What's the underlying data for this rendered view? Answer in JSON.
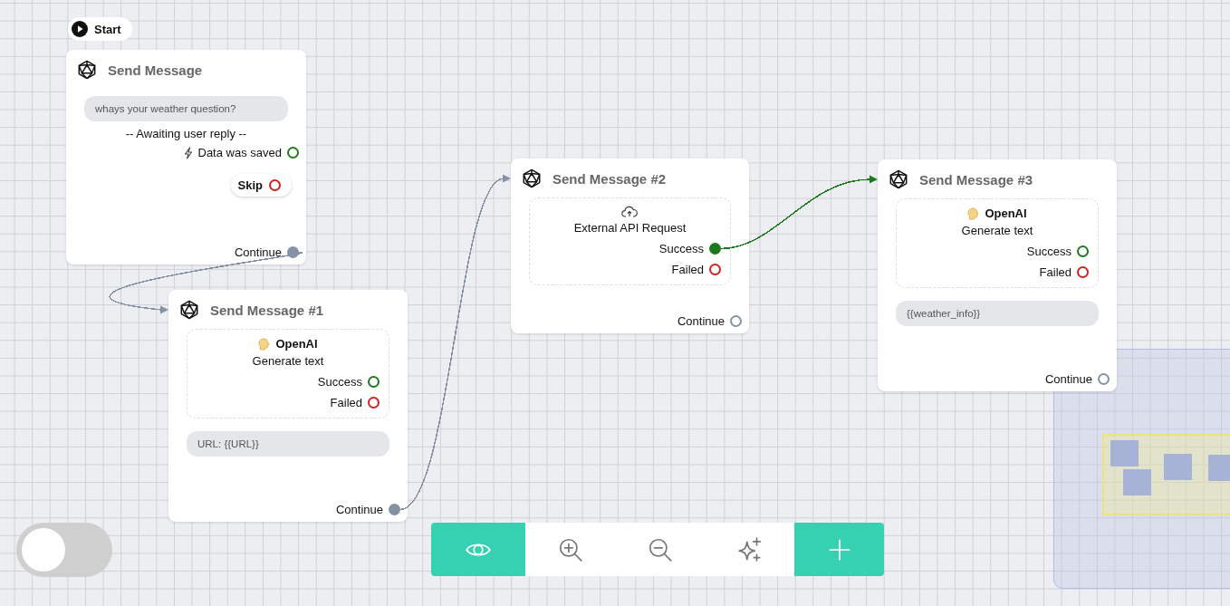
{
  "start": {
    "label": "Start"
  },
  "nodes": [
    {
      "title": "Send Message",
      "items": [
        {
          "kind": "bubble",
          "text": "whays your weather question?"
        },
        {
          "kind": "note",
          "text": "-- Awaiting user reply --"
        },
        {
          "kind": "event",
          "label": "Data was saved",
          "color": "#1f7a1f",
          "connected": false
        },
        {
          "kind": "button",
          "label": "Skip",
          "color": "#cc2222",
          "connected": false
        }
      ],
      "continue": {
        "label": "Continue",
        "color": "#8592a6",
        "connected": true
      }
    },
    {
      "title": "Send Message #1",
      "items": [
        {
          "kind": "ai_step",
          "name": "OpenAI",
          "action": "Generate text",
          "ports": [
            {
              "label": "Success",
              "color": "#1f7a1f",
              "connected": false
            },
            {
              "label": "Failed",
              "color": "#cc2222",
              "connected": false
            }
          ]
        },
        {
          "kind": "bubble",
          "text": "URL: {{URL}}"
        }
      ],
      "continue": {
        "label": "Continue",
        "color": "#8592a6",
        "connected": true
      }
    },
    {
      "title": "Send Message #2",
      "items": [
        {
          "kind": "api_step",
          "action": "External API Request",
          "ports": [
            {
              "label": "Success",
              "color": "#1f7a1f",
              "connected": true
            },
            {
              "label": "Failed",
              "color": "#cc2222",
              "connected": false
            }
          ]
        }
      ],
      "continue": {
        "label": "Continue",
        "color": "#8592a6",
        "connected": false
      }
    },
    {
      "title": "Send Message #3",
      "items": [
        {
          "kind": "ai_step",
          "name": "OpenAI",
          "action": "Generate text",
          "ports": [
            {
              "label": "Success",
              "color": "#1f7a1f",
              "connected": false
            },
            {
              "label": "Failed",
              "color": "#cc2222",
              "connected": false
            }
          ]
        },
        {
          "kind": "bubble",
          "text": "{{weather_info}}"
        }
      ],
      "continue": {
        "label": "Continue",
        "color": "#8592a6",
        "connected": false
      }
    }
  ],
  "toggle": {
    "on": false
  },
  "toolbar": [
    {
      "kind": "view",
      "highlighted": true
    },
    {
      "kind": "zoom_in",
      "highlighted": false
    },
    {
      "kind": "zoom_out",
      "highlighted": false
    },
    {
      "kind": "magic",
      "highlighted": false
    },
    {
      "kind": "add",
      "highlighted": true
    }
  ]
}
